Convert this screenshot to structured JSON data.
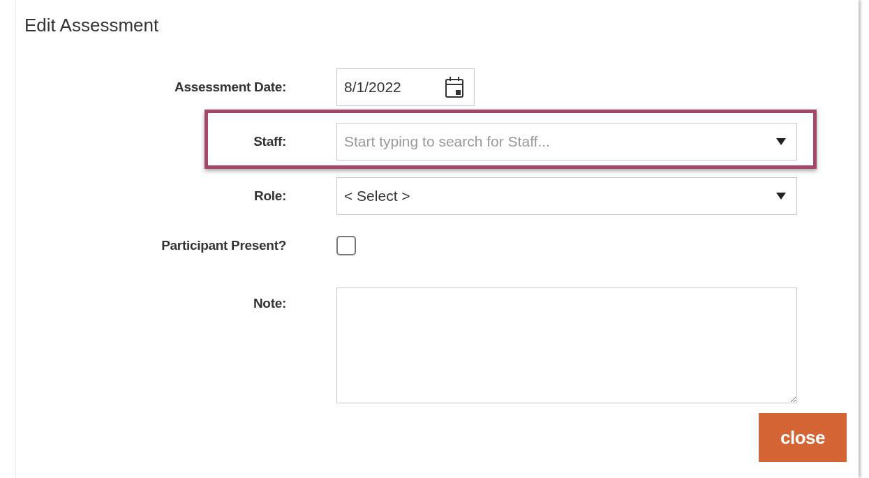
{
  "dialog": {
    "title": "Edit Assessment"
  },
  "fields": [
    {
      "kind": "date",
      "label": "Assessment Date:",
      "value": "8/1/2022",
      "highlighted": false
    },
    {
      "kind": "combo",
      "label": "Staff:",
      "placeholder": "Start typing to search for Staff...",
      "highlighted": true
    },
    {
      "kind": "select",
      "label": "Role:",
      "value": "< Select >",
      "highlighted": false
    },
    {
      "kind": "checkbox",
      "label": "Participant Present?",
      "checked": false,
      "highlighted": false
    },
    {
      "kind": "textarea",
      "label": "Note:",
      "highlighted": false
    }
  ],
  "buttons": [
    {
      "label": "close"
    }
  ]
}
